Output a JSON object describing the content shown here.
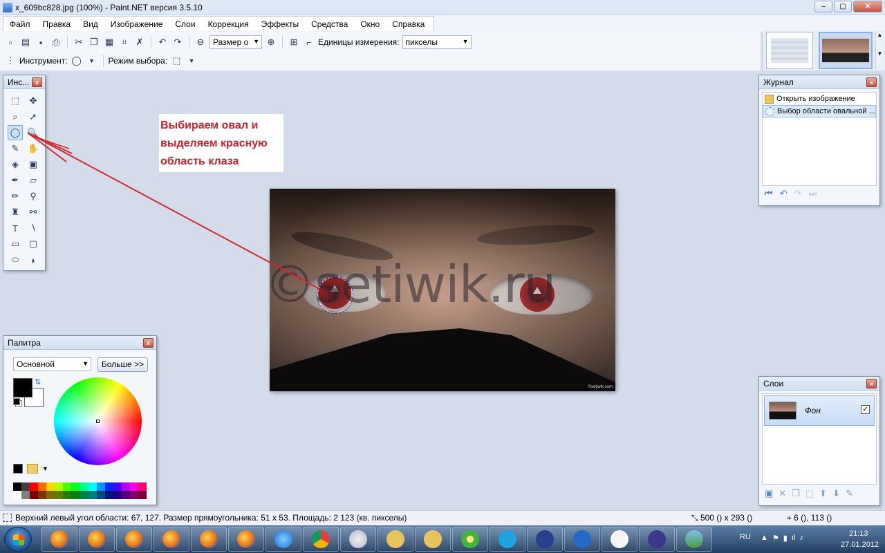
{
  "window": {
    "title": "x_609bc828.jpg (100%) - Paint.NET версия 3.5.10",
    "buttons": [
      "–",
      "▢",
      "✕"
    ]
  },
  "menu": {
    "items": [
      "Файл",
      "Правка",
      "Вид",
      "Изображение",
      "Слои",
      "Коррекция",
      "Эффекты",
      "Средства",
      "Окно",
      "Справка"
    ]
  },
  "toolbar": {
    "zoom_value": "Размер о",
    "units_label": "Единицы измерения:",
    "units_value": "пикселы",
    "tool_label": "Инструмент:",
    "mode_label": "Режим выбора:"
  },
  "tools_panel": {
    "title": "Инс...",
    "close": "x",
    "tools": [
      {
        "icon": "rect-select-icon",
        "glyph": "⬚",
        "active": false
      },
      {
        "icon": "move-selected-icon",
        "glyph": "✥",
        "active": false
      },
      {
        "icon": "lasso-select-icon",
        "glyph": "⌕",
        "active": false
      },
      {
        "icon": "move-selection-icon",
        "glyph": "➚",
        "active": false
      },
      {
        "icon": "ellipse-select-icon",
        "glyph": "◯",
        "active": true
      },
      {
        "icon": "zoom-icon",
        "glyph": "🔍",
        "active": false
      },
      {
        "icon": "magic-wand-icon",
        "glyph": "✎",
        "active": false
      },
      {
        "icon": "pan-icon",
        "glyph": "✋",
        "active": false
      },
      {
        "icon": "paint-bucket-icon",
        "glyph": "◈",
        "active": false
      },
      {
        "icon": "gradient-icon",
        "glyph": "▣",
        "active": false
      },
      {
        "icon": "paintbrush-icon",
        "glyph": "✒",
        "active": false
      },
      {
        "icon": "eraser-icon",
        "glyph": "▱",
        "active": false
      },
      {
        "icon": "pencil-icon",
        "glyph": "✏",
        "active": false
      },
      {
        "icon": "color-picker-icon",
        "glyph": "⚲",
        "active": false
      },
      {
        "icon": "clone-stamp-icon",
        "glyph": "♜",
        "active": false
      },
      {
        "icon": "recolor-icon",
        "glyph": "⚯",
        "active": false
      },
      {
        "icon": "text-icon",
        "glyph": "T",
        "active": false
      },
      {
        "icon": "line-curve-icon",
        "glyph": "∖",
        "active": false
      },
      {
        "icon": "rectangle-icon",
        "glyph": "▭",
        "active": false
      },
      {
        "icon": "rounded-rectangle-icon",
        "glyph": "▢",
        "active": false
      },
      {
        "icon": "ellipse-icon",
        "glyph": "⬭",
        "active": false
      },
      {
        "icon": "freeform-shape-icon",
        "glyph": "◗",
        "active": false
      }
    ]
  },
  "annotation": {
    "lines": [
      "Выбираем овал и",
      "выделяем красную",
      "область клаза"
    ],
    "color": "#c8242b"
  },
  "canvas": {
    "watermark": "©setiwik.ru",
    "corner_mark": "©setiwik.com"
  },
  "palette_panel": {
    "title": "Палитра",
    "close": "x",
    "mode_value": "Основной",
    "more_button": "Больше >>",
    "primary_color": "#000000",
    "secondary_color": "#ffffff",
    "swatches_top": [
      "#000000",
      "#404040",
      "#ff0000",
      "#ff6a00",
      "#ffd800",
      "#b6ff00",
      "#4cff00",
      "#00ff21",
      "#00ff90",
      "#00ffff",
      "#0094ff",
      "#0026ff",
      "#4800ff",
      "#b200ff",
      "#ff00dc",
      "#ff006e"
    ],
    "swatches_bottom": [
      "#ffffff",
      "#808080",
      "#7f0000",
      "#7f3300",
      "#7f6a00",
      "#5b7f00",
      "#267f00",
      "#007f0e",
      "#007f46",
      "#007f7f",
      "#004a7f",
      "#00137f",
      "#21007f",
      "#57007f",
      "#7f006e",
      "#7f0037"
    ]
  },
  "journal_panel": {
    "title": "Журнал",
    "close": "x",
    "items": [
      {
        "label": "Открыть изображение",
        "icon": "open-image-icon"
      },
      {
        "label": "Выбор области овальной ...",
        "icon": "ellipse-select-icon"
      }
    ],
    "controls": [
      "⏮",
      "↶",
      "↷",
      "⏭"
    ]
  },
  "layers_panel": {
    "title": "Слои",
    "close": "x",
    "layer_name": "Фон",
    "layer_visible_mark": "✓",
    "controls": [
      "▣",
      "✕",
      "❐",
      "⬚",
      "⬆",
      "⬇",
      "✎"
    ]
  },
  "status": {
    "selection_info": "Верхний левый угол области: 67, 127. Размер прямоугольника: 51 x 53. Площадь: 2 123 (кв. пикселы)",
    "image_size": "500 () x 293 ()",
    "cursor_pos": "6 (), 113 ()"
  },
  "taskbar": {
    "apps": [
      "firefox-icon",
      "firefox-icon",
      "firefox-icon",
      "firefox-icon",
      "firefox-icon",
      "firefox-icon",
      "ie-icon",
      "chrome-icon",
      "paint-icon",
      "folder-icon",
      "folder-icon",
      "icq-icon",
      "skype-icon",
      "safesurf-icon",
      "help-icon",
      "word-doc-icon",
      "paintnet-icon",
      "image-viewer-icon"
    ],
    "language": "RU",
    "time": "21:13",
    "date": "27.01.2012"
  }
}
